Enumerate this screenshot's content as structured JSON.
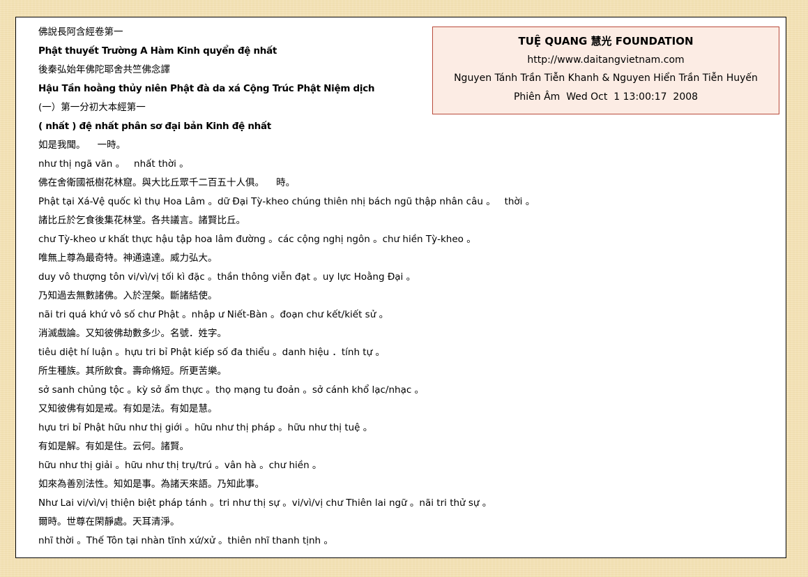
{
  "header_box": {
    "title": "TUỆ QUANG 慧光 FOUNDATION",
    "url": "http://www.daitangvietnam.com",
    "authors": "Nguyen Tánh Trần Tiễn Khanh & Nguyen Hiển Trần Tiễn Huyến",
    "timestamp": "Phiên Âm  Wed Oct  1 13:00:17  2008"
  },
  "lines": [
    {
      "text": "佛說長阿含經卷第一",
      "bold": false
    },
    {
      "text": "Phật thuyết Trường A Hàm Kinh quyển đệ nhất",
      "bold": true
    },
    {
      "text": "後秦弘始年佛陀耶舍共竺佛念譯",
      "bold": false
    },
    {
      "text": "Hậu Tần hoằng thủy niên Phật đà da xá Cộng Trúc Phật Niệm dịch",
      "bold": true
    },
    {
      "text": "(一）第一分初大本經第一",
      "bold": false
    },
    {
      "text": "( nhất ) đệ nhất phân sơ đại bản Kinh đệ nhất",
      "bold": true
    },
    {
      "text": "如是我聞。    一時。",
      "bold": false
    },
    {
      "text": "như thị ngã văn 。   nhất thời 。",
      "bold": false
    },
    {
      "text": "佛在舍衛國祇樹花林窟。與大比丘眾千二百五十人俱。    時。",
      "bold": false
    },
    {
      "text": "Phật tại Xá-Vệ quốc kì thụ Hoa Lâm 。dữ Đại Tỳ-kheo chúng thiên nhị bách ngũ thập nhân câu 。   thời 。",
      "bold": false
    },
    {
      "text": "諸比丘於乞食後集花林堂。各共議言。諸賢比丘。",
      "bold": false
    },
    {
      "text": "chư Tỳ-kheo ư khất thực hậu tập hoa lâm đường 。các cộng nghị ngôn 。chư hiền Tỳ-kheo 。",
      "bold": false
    },
    {
      "text": "唯無上尊為最奇特。神通遠達。威力弘大。",
      "bold": false
    },
    {
      "text": "duy vô thượng tôn vi/vì/vị tối kì đặc 。thần thông viễn đạt 。uy lực Hoằng Đại 。",
      "bold": false
    },
    {
      "text": "乃知過去無數諸佛。入於涅槃。斷諸結使。",
      "bold": false
    },
    {
      "text": "nãi tri quá khứ vô số chư Phật 。nhập ư Niết-Bàn 。đoạn chư kết/kiết sử 。",
      "bold": false
    },
    {
      "text": "消滅戲論。又知彼佛劫數多少。名號．姓字。",
      "bold": false
    },
    {
      "text": "tiêu diệt hí luận 。hựu tri bỉ Phật kiếp số đa thiểu 。danh hiệu ．tính tự 。",
      "bold": false
    },
    {
      "text": "所生種族。其所飲食。壽命脩短。所更苦樂。",
      "bold": false
    },
    {
      "text": "sở sanh chủng tộc 。kỳ sở ẩm thực 。thọ mạng tu đoản 。sở cánh khổ lạc/nhạc 。",
      "bold": false
    },
    {
      "text": "又知彼佛有如是戒。有如是法。有如是慧。",
      "bold": false
    },
    {
      "text": "hựu tri bỉ Phật hữu như thị giới 。hữu như thị pháp 。hữu như thị tuệ 。",
      "bold": false
    },
    {
      "text": "有如是解。有如是住。云何。諸賢。",
      "bold": false
    },
    {
      "text": "hữu như thị giải 。hữu như thị trụ/trú 。vân hà 。chư hiền 。",
      "bold": false
    },
    {
      "text": "如來為善別法性。知如是事。為諸天來語。乃知此事。",
      "bold": false
    },
    {
      "text": "Như Lai vi/vì/vị thiện biệt pháp tánh 。tri như thị sự 。vi/vì/vị chư Thiên lai ngữ 。nãi tri thử sự 。",
      "bold": false
    },
    {
      "text": "爾時。世尊在閑靜處。天耳清淨。",
      "bold": false
    },
    {
      "text": "nhĩ thời 。Thế Tôn tại nhàn tĩnh xứ/xử 。thiên nhĩ thanh tịnh 。",
      "bold": false
    }
  ]
}
